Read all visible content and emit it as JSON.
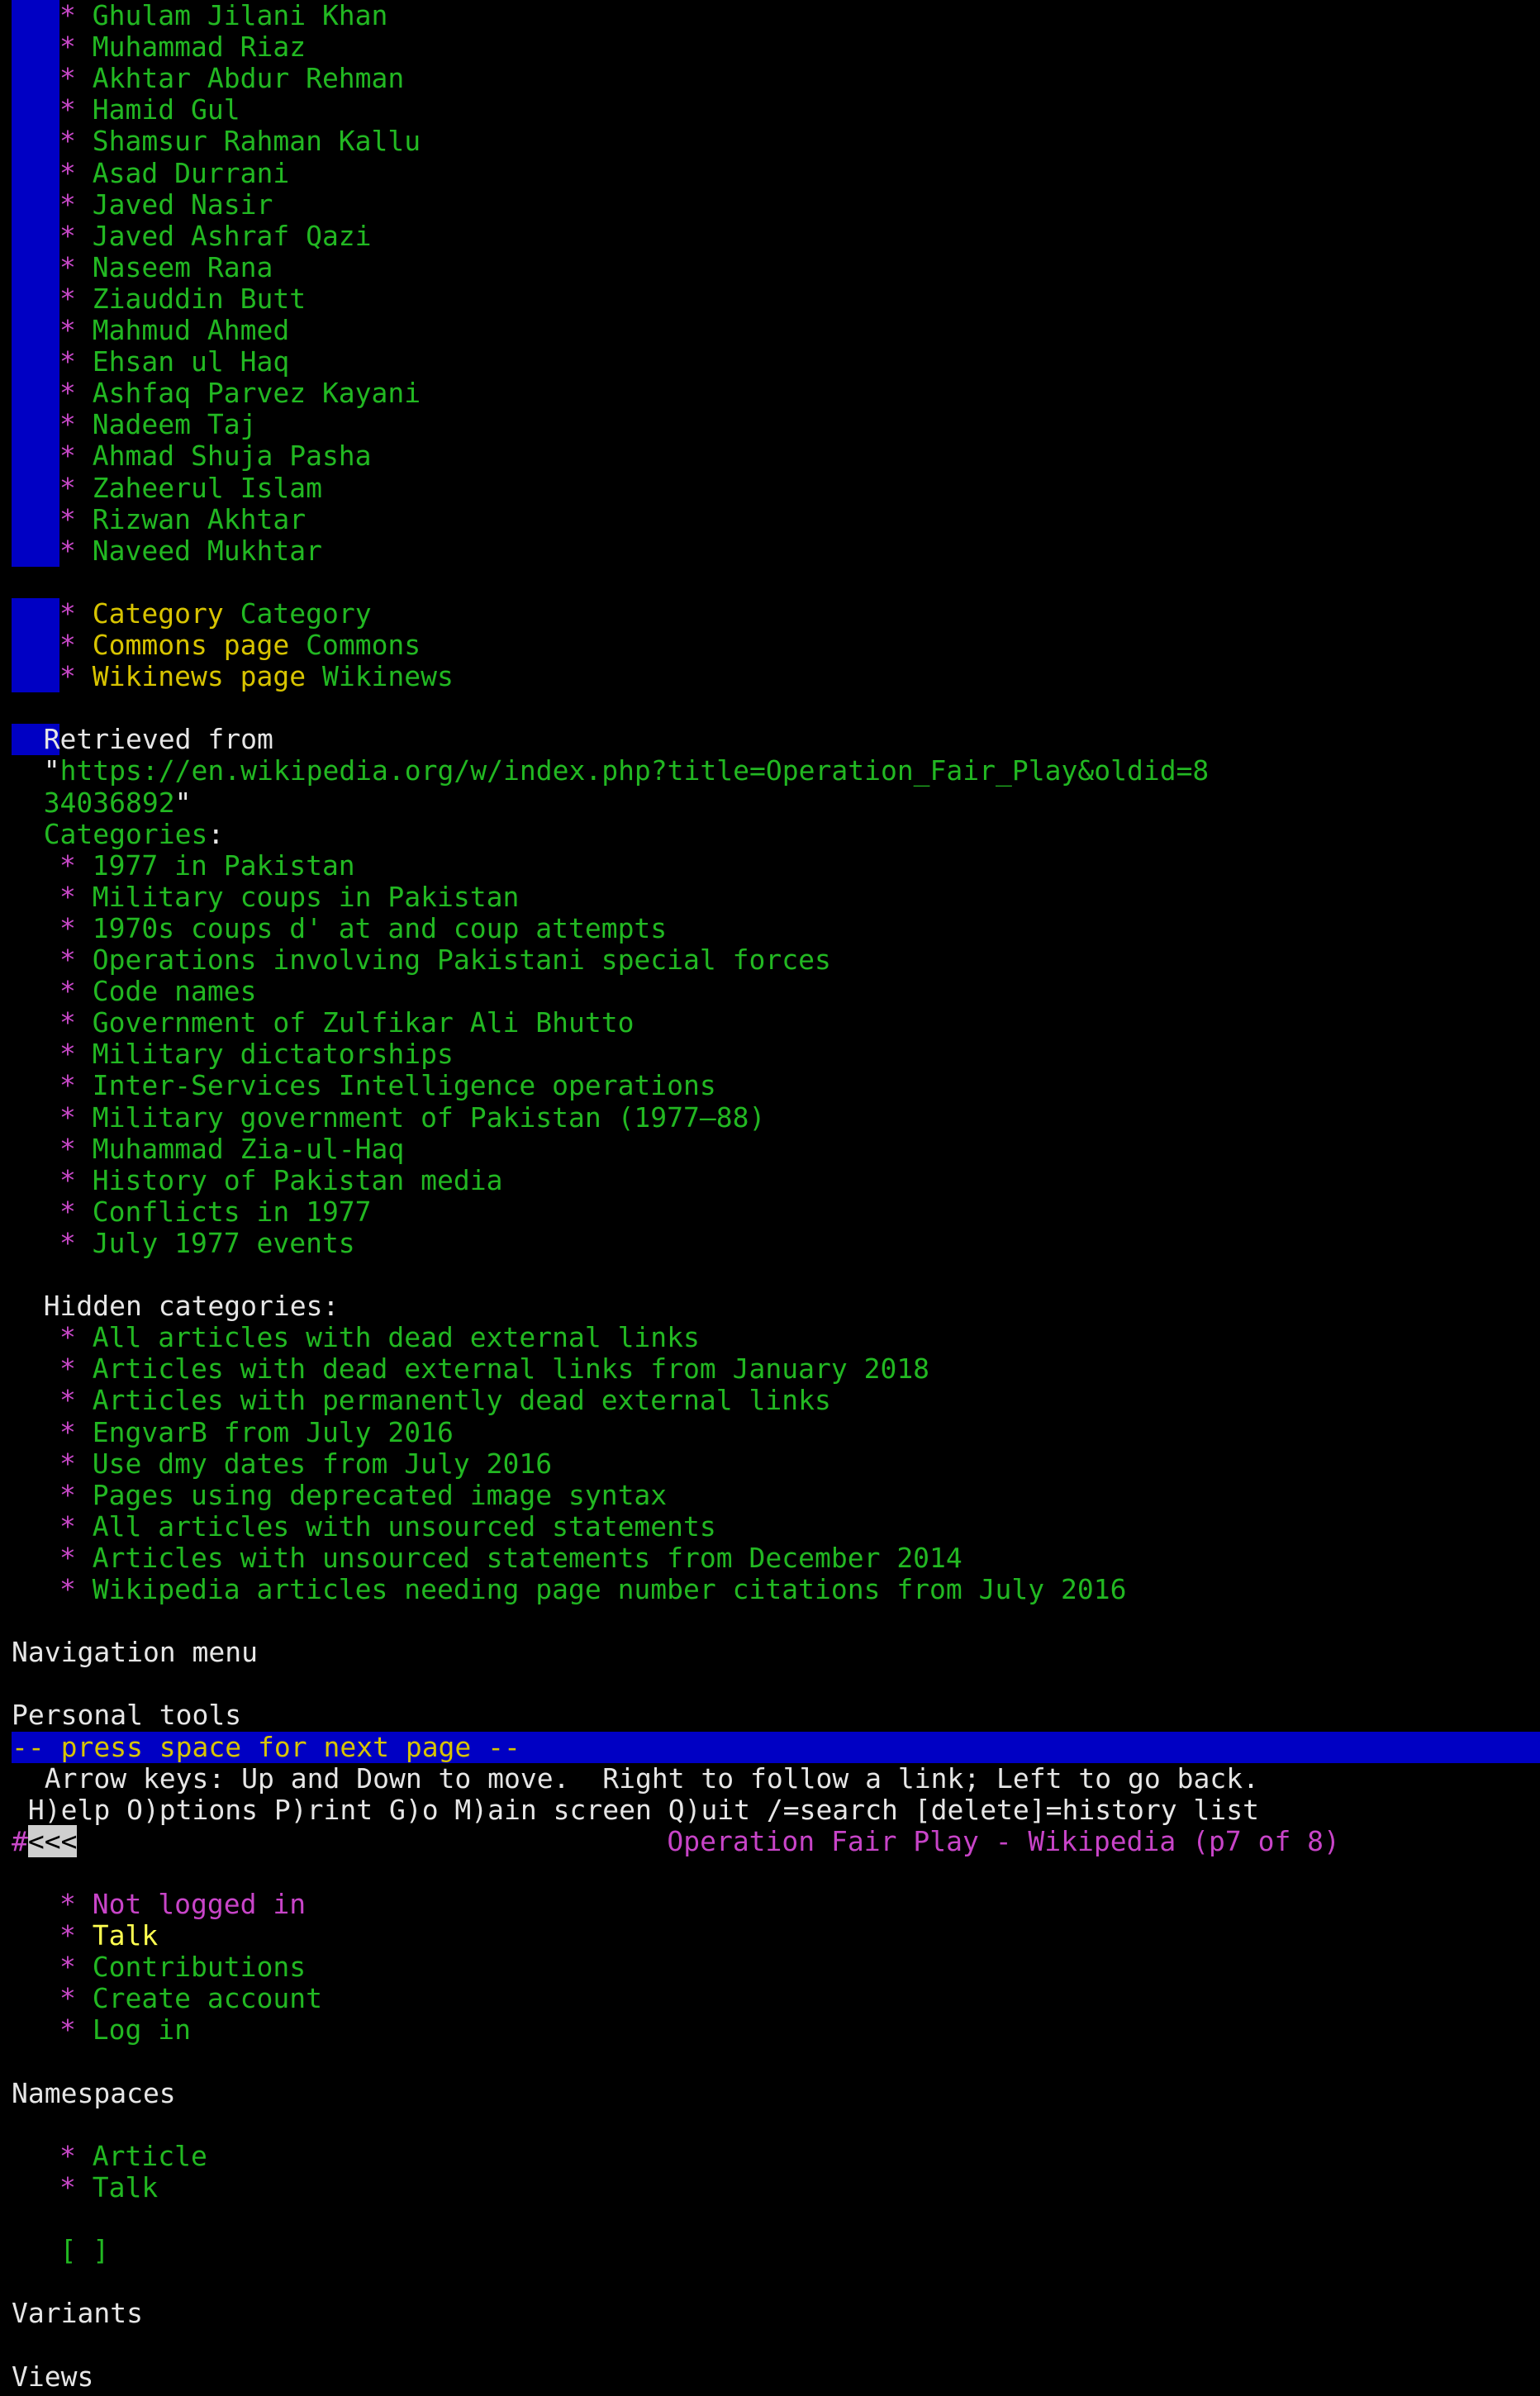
{
  "top_list": [
    "Ghulam Jilani Khan",
    "Muhammad Riaz",
    "Akhtar Abdur Rehman",
    "Hamid Gul",
    "Shamsur Rahman Kallu",
    "Asad Durrani",
    "Javed Nasir",
    "Javed Ashraf Qazi",
    "Naseem Rana",
    "Ziauddin Butt",
    "Mahmud Ahmed",
    "Ehsan ul Haq",
    "Ashfaq Parvez Kayani",
    "Nadeem Taj",
    "Ahmad Shuja Pasha",
    "Zaheerul Islam",
    "Rizwan Akhtar",
    "Naveed Mukhtar"
  ],
  "sister_projects": [
    {
      "label": "Category",
      "link": "Category"
    },
    {
      "label": "Commons page",
      "link": "Commons"
    },
    {
      "label": "Wikinews page",
      "link": "Wikinews"
    }
  ],
  "retrieved": {
    "prefix": "Retrieved from",
    "quote_open": "\"",
    "url_line1": "https://en.wikipedia.org/w/index.php?title=Operation_Fair_Play&oldid=8",
    "url_line2": "34036892",
    "quote_close": "\""
  },
  "categories_label": "Categories",
  "categories_colon": ":",
  "categories": [
    "1977 in Pakistan",
    "Military coups in Pakistan",
    "1970s coups d' at and coup attempts",
    "Operations involving Pakistani special forces",
    "Code names",
    "Government of Zulfikar Ali Bhutto",
    "Military dictatorships",
    "Inter-Services Intelligence operations",
    "Military government of Pakistan (1977–88)",
    "Muhammad Zia-ul-Haq",
    "History of Pakistan media",
    "Conflicts in 1977",
    "July 1977 events"
  ],
  "hidden_categories_label": "Hidden categories:",
  "hidden_categories": [
    "All articles with dead external links",
    "Articles with dead external links from January 2018",
    "Articles with permanently dead external links",
    "EngvarB from July 2016",
    "Use dmy dates from July 2016",
    "Pages using deprecated image syntax",
    "All articles with unsourced statements",
    "Articles with unsourced statements from December 2014",
    "Wikipedia articles needing page number citations from July 2016"
  ],
  "navigation_menu": "Navigation menu",
  "personal_tools": "Personal tools",
  "status_bar": "-- press space for next page --",
  "help_line1": "  Arrow keys: Up and Down to move.  Right to follow a link; Left to go back.",
  "help_line2": " H)elp O)ptions P)rint G)o M)ain screen Q)uit /=search [delete]=history list",
  "title_hash": "#",
  "title_back": "<<<",
  "title_text": "Operation Fair Play - Wikipedia (p7 of 8)",
  "personal_items": [
    {
      "text": "Not logged in",
      "style": "m"
    },
    {
      "text": "Talk",
      "style": "yel"
    },
    {
      "text": "Contributions",
      "style": "g"
    },
    {
      "text": "Create account",
      "style": "g"
    },
    {
      "text": "Log in",
      "style": "g"
    }
  ],
  "namespaces": "Namespaces",
  "namespace_items": [
    {
      "text": "Article",
      "style": "g"
    },
    {
      "text": "Talk",
      "style": "g"
    }
  ],
  "brackets": "[ ]",
  "variants": "Variants",
  "views": "Views",
  "bullet": "* ",
  "colors": {
    "bar": "#0000c4",
    "link": "#22b822",
    "yellow": "#d8c400",
    "magenta": "#c848c8"
  }
}
